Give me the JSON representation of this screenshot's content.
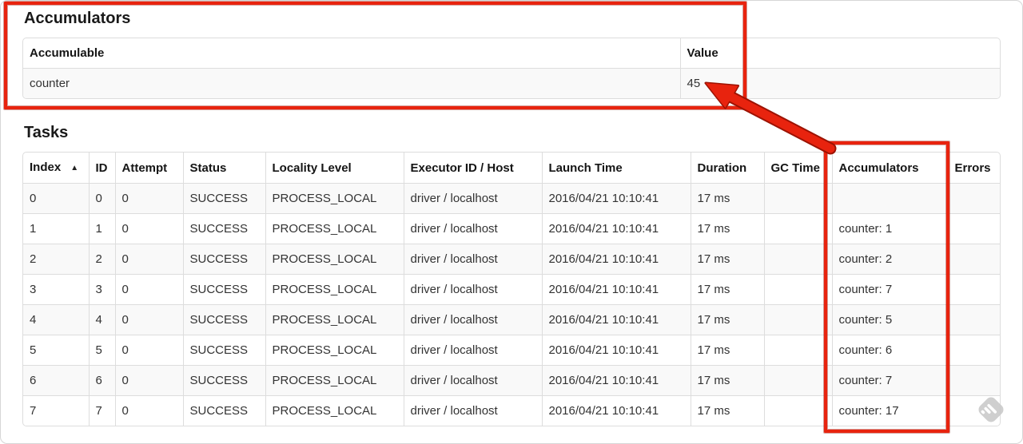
{
  "accumulators_section": {
    "title": "Accumulators",
    "table": {
      "headers": [
        "Accumulable",
        "Value"
      ],
      "rows": [
        [
          "counter",
          "45"
        ]
      ]
    }
  },
  "tasks_section": {
    "title": "Tasks",
    "sort_icon": "▲",
    "table": {
      "headers": [
        "Index",
        "ID",
        "Attempt",
        "Status",
        "Locality Level",
        "Executor ID / Host",
        "Launch Time",
        "Duration",
        "GC Time",
        "Accumulators",
        "Errors"
      ],
      "rows": [
        [
          "0",
          "0",
          "0",
          "SUCCESS",
          "PROCESS_LOCAL",
          "driver / localhost",
          "2016/04/21 10:10:41",
          "17 ms",
          "",
          "",
          ""
        ],
        [
          "1",
          "1",
          "0",
          "SUCCESS",
          "PROCESS_LOCAL",
          "driver / localhost",
          "2016/04/21 10:10:41",
          "17 ms",
          "",
          "counter: 1",
          ""
        ],
        [
          "2",
          "2",
          "0",
          "SUCCESS",
          "PROCESS_LOCAL",
          "driver / localhost",
          "2016/04/21 10:10:41",
          "17 ms",
          "",
          "counter: 2",
          ""
        ],
        [
          "3",
          "3",
          "0",
          "SUCCESS",
          "PROCESS_LOCAL",
          "driver / localhost",
          "2016/04/21 10:10:41",
          "17 ms",
          "",
          "counter: 7",
          ""
        ],
        [
          "4",
          "4",
          "0",
          "SUCCESS",
          "PROCESS_LOCAL",
          "driver / localhost",
          "2016/04/21 10:10:41",
          "17 ms",
          "",
          "counter: 5",
          ""
        ],
        [
          "5",
          "5",
          "0",
          "SUCCESS",
          "PROCESS_LOCAL",
          "driver / localhost",
          "2016/04/21 10:10:41",
          "17 ms",
          "",
          "counter: 6",
          ""
        ],
        [
          "6",
          "6",
          "0",
          "SUCCESS",
          "PROCESS_LOCAL",
          "driver / localhost",
          "2016/04/21 10:10:41",
          "17 ms",
          "",
          "counter: 7",
          ""
        ],
        [
          "7",
          "7",
          "0",
          "SUCCESS",
          "PROCESS_LOCAL",
          "driver / localhost",
          "2016/04/21 10:10:41",
          "17 ms",
          "",
          "counter: 17",
          ""
        ]
      ]
    }
  },
  "colors": {
    "annotation_red": "#e8230e",
    "annotation_red_dark": "#9c1202",
    "table_border": "#dddddd",
    "row_stripe": "#f9f9f9"
  }
}
